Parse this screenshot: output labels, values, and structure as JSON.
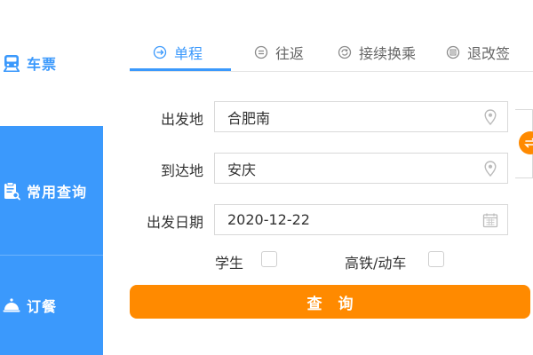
{
  "sidebar": {
    "items": [
      {
        "label": "车票",
        "icon": "train-icon",
        "active": true
      },
      {
        "label": "常用查询",
        "icon": "clipboard-search-icon",
        "active": false
      },
      {
        "label": "订餐",
        "icon": "dish-cover-icon",
        "active": false
      }
    ]
  },
  "tabs": [
    {
      "label": "单程",
      "icon": "arrow-circle-icon",
      "active": true
    },
    {
      "label": "往返",
      "icon": "equal-circle-icon",
      "active": false
    },
    {
      "label": "接续换乘",
      "icon": "refresh-circle-icon",
      "active": false
    },
    {
      "label": "退改签",
      "icon": "ticket-circle-icon",
      "active": false
    }
  ],
  "form": {
    "from_label": "出发地",
    "from_value": "合肥南",
    "to_label": "到达地",
    "to_value": "安庆",
    "date_label": "出发日期",
    "date_value": "2020-12-22",
    "student_label": "学生",
    "highspeed_label": "高铁/动车",
    "search_label": "查询"
  },
  "colors": {
    "accent_blue": "#3b99fc",
    "accent_orange": "#ff8a00"
  }
}
